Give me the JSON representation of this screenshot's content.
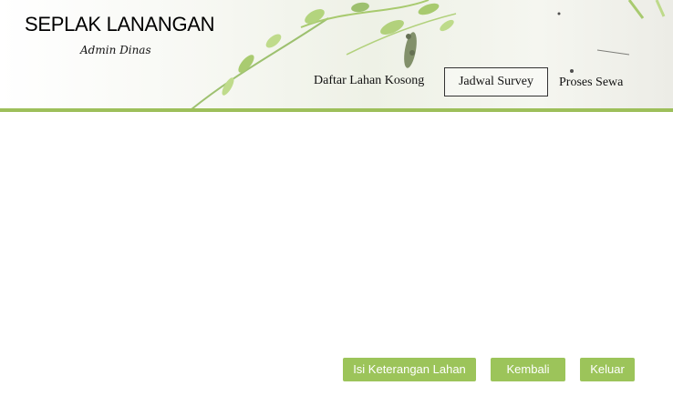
{
  "app": {
    "title": "SEPLAK LANANGAN",
    "subtitle": "Admin Dinas"
  },
  "nav": {
    "items": [
      {
        "label": "Daftar Lahan Kosong"
      },
      {
        "label": "Jadwal Survey"
      },
      {
        "label": "Proses Sewa"
      }
    ],
    "active": "Jadwal Survey"
  },
  "actions": {
    "info_label": "Isi Keterangan Lahan",
    "back_label": "Kembali",
    "logout_label": "Keluar"
  },
  "colors": {
    "accent": "#9cc45a",
    "header_line": "#9dbf5a"
  }
}
